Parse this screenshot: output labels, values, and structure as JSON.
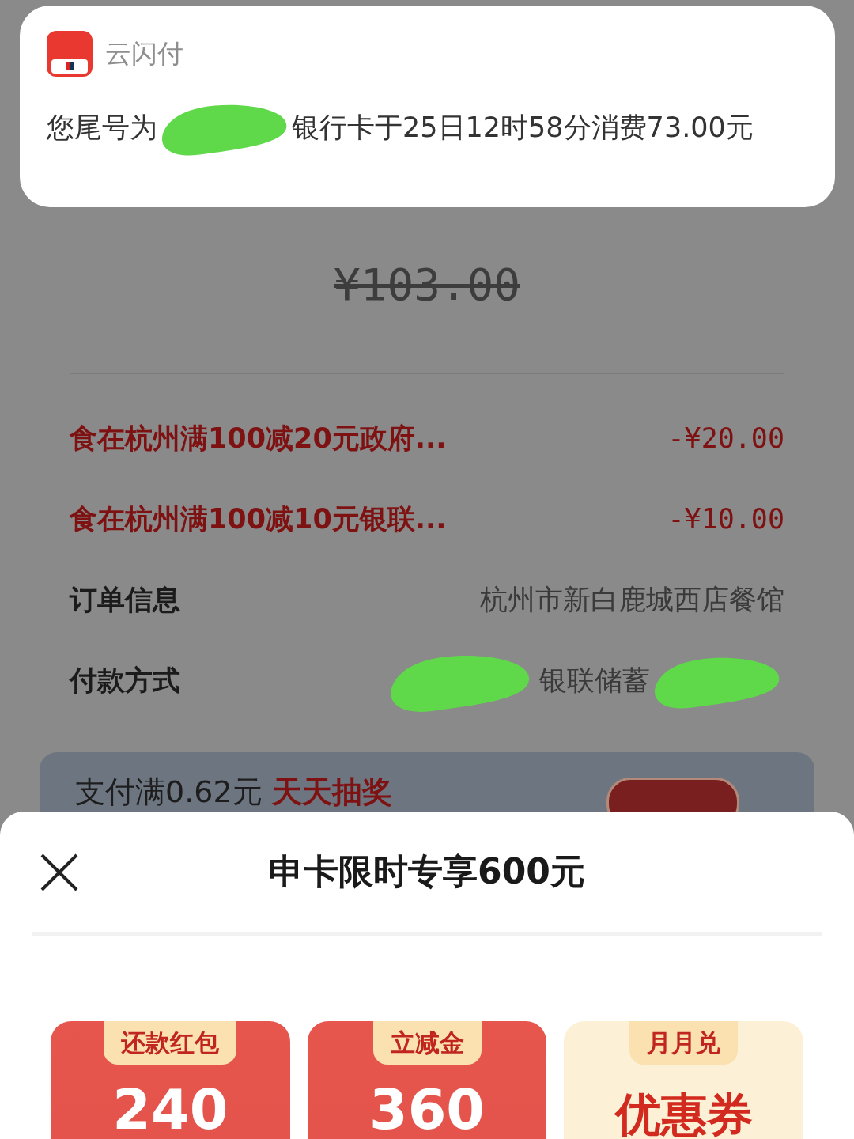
{
  "notification": {
    "app_name": "云闪付",
    "message_start": "您尾号为",
    "message_end": "银行卡于25日12时58分消费73.00元"
  },
  "original_price": "¥103.00",
  "discounts": [
    {
      "label": "食在杭州满100减20元政府...",
      "amount": "-¥20.00"
    },
    {
      "label": "食在杭州满100减10元银联...",
      "amount": "-¥10.00"
    }
  ],
  "info_rows": [
    {
      "label": "订单信息",
      "value": "杭州市新白鹿城西店餐馆",
      "redacted": false
    },
    {
      "label": "付款方式",
      "value": "银联储蓄",
      "redacted": true
    }
  ],
  "promo": {
    "text": "支付满0.62元",
    "highlight": "天天抽奖"
  },
  "sheet": {
    "title": "申卡限时专享600元",
    "cards": [
      {
        "tag": "还款红包",
        "value": "240",
        "kind": "cash"
      },
      {
        "tag": "立减金",
        "value": "360",
        "kind": "cash"
      },
      {
        "tag": "月月兑",
        "value": "优惠券",
        "kind": "coupon"
      }
    ]
  }
}
